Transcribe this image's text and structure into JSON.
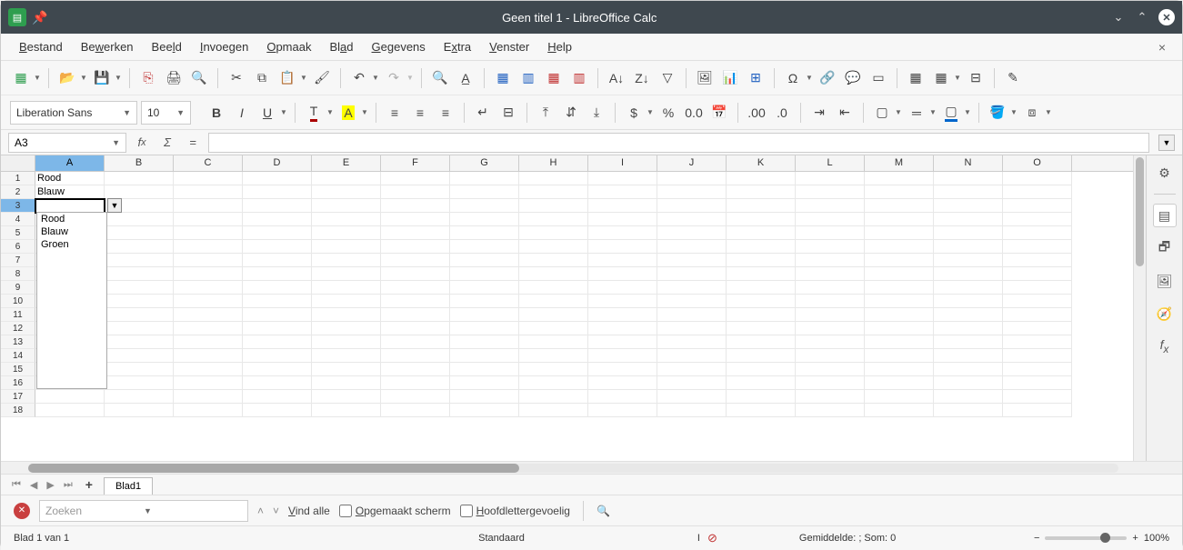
{
  "titlebar": {
    "title": "Geen titel 1 - LibreOffice Calc"
  },
  "menubar": {
    "items": [
      "Bestand",
      "Bewerken",
      "Beeld",
      "Invoegen",
      "Opmaak",
      "Blad",
      "Gegevens",
      "Extra",
      "Venster",
      "Help"
    ],
    "underlines": [
      "B",
      "w",
      "l",
      "I",
      "O",
      "a",
      "G",
      "x",
      "V",
      "H"
    ]
  },
  "font": {
    "name": "Liberation Sans",
    "size": "10"
  },
  "namebox": "A3",
  "columns": [
    "A",
    "B",
    "C",
    "D",
    "E",
    "F",
    "G",
    "H",
    "I",
    "J",
    "K",
    "L",
    "M",
    "N",
    "O"
  ],
  "row_count": 18,
  "active_col": 0,
  "active_row": 2,
  "cells": {
    "A1": "Rood",
    "A2": "Blauw"
  },
  "autocomplete": [
    "Rood",
    "Blauw",
    "Groen"
  ],
  "sheet": {
    "tab": "Blad1"
  },
  "search": {
    "placeholder": "Zoeken",
    "findall": "Vind alle",
    "formatted": "Opgemaakt scherm",
    "matchcase": "Hoofdlettergevoelig"
  },
  "status": {
    "sheet": "Blad 1 van 1",
    "style": "Standaard",
    "summary": "Gemiddelde: ; Som: 0",
    "zoom": "100%"
  }
}
